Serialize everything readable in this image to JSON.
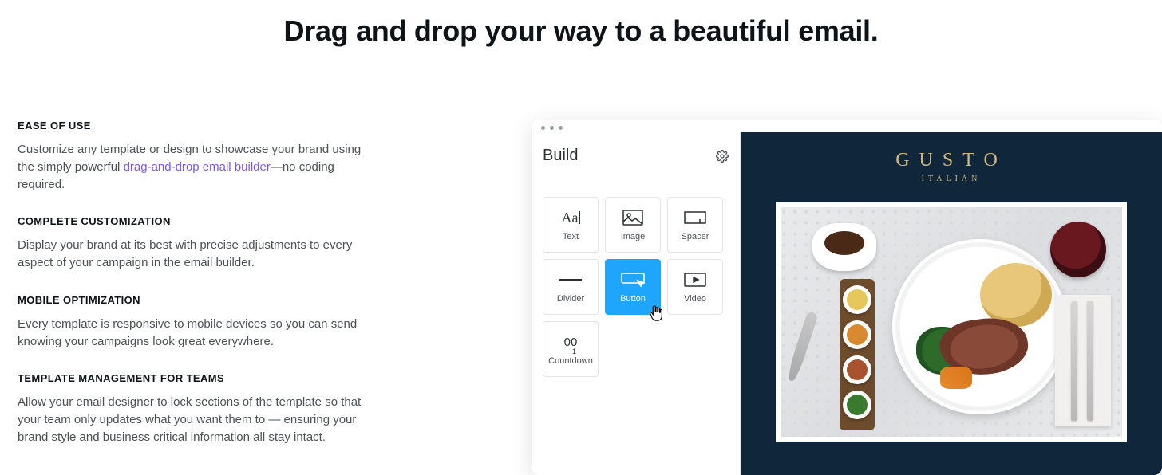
{
  "headline": "Drag and drop your way to a beautiful email.",
  "features": [
    {
      "title": "EASE OF USE",
      "text_before": "Customize any template or design to showcase your brand using the simply powerful ",
      "link": "drag-and-drop email builder",
      "text_after": "—no coding required."
    },
    {
      "title": "COMPLETE CUSTOMIZATION",
      "text": "Display your brand at its best with precise adjustments to every aspect of your campaign in the email builder."
    },
    {
      "title": "MOBILE OPTIMIZATION",
      "text": "Every template is responsive to mobile devices so you can send knowing your campaigns look great everywhere."
    },
    {
      "title": "TEMPLATE MANAGEMENT FOR TEAMS",
      "text": "Allow your email designer to lock sections of the template so that your team only updates what you want them to — ensuring your brand style and business critical information all stay intact."
    }
  ],
  "builder": {
    "panel_title": "Build",
    "tiles": {
      "text": "Text",
      "image": "Image",
      "spacer": "Spacer",
      "divider": "Divider",
      "button": "Button",
      "video": "Video",
      "countdown": "Countdown"
    },
    "active_tile": "button"
  },
  "email_preview": {
    "brand": "GUSTO",
    "tagline": "ITALIAN"
  }
}
